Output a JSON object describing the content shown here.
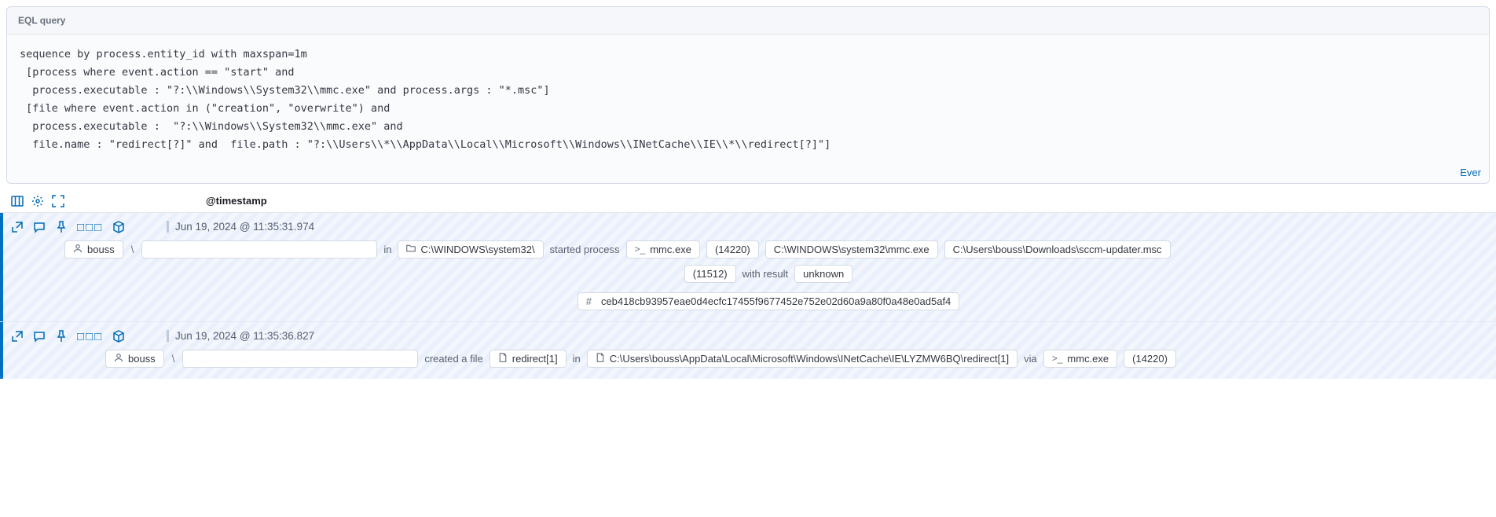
{
  "panel": {
    "title": "EQL query",
    "query": "sequence by process.entity_id with maxspan=1m\n [process where event.action == \"start\" and\n  process.executable : \"?:\\\\Windows\\\\System32\\\\mmc.exe\" and process.args : \"*.msc\"]\n [file where event.action in (\"creation\", \"overwrite\") and\n  process.executable :  \"?:\\\\Windows\\\\System32\\\\mmc.exe\" and\n  file.name : \"redirect[?]\" and  file.path : \"?:\\\\Users\\\\*\\\\AppData\\\\Local\\\\Microsoft\\\\Windows\\\\INetCache\\\\IE\\\\*\\\\redirect[?]\"]",
    "footer_link": "Ever"
  },
  "toolbar": {
    "timestamp_header": "@timestamp"
  },
  "events": [
    {
      "timestamp": "Jun 19, 2024 @ 11:35:31.974",
      "user": "bouss",
      "sep": "\\",
      "in_label": "in",
      "working_dir": "C:\\WINDOWS\\system32\\",
      "started_label": "started process",
      "proc_name": "mmc.exe",
      "pid": "(14220)",
      "proc_path": "C:\\WINDOWS\\system32\\mmc.exe",
      "arg_path": "C:\\Users\\bouss\\Downloads\\sccm-updater.msc",
      "child_pid": "(11512)",
      "with_result_label": "with result",
      "result": "unknown",
      "hash_prefix": "#",
      "hash": "ceb418cb93957eae0d4ecfc17455f9677452e752e02d60a9a80f0a48e0ad5af4"
    },
    {
      "timestamp": "Jun 19, 2024 @ 11:35:36.827",
      "user": "bouss",
      "sep": "\\",
      "created_label": "created a file",
      "file_name": "redirect[1]",
      "in_label": "in",
      "file_path": "C:\\Users\\bouss\\AppData\\Local\\Microsoft\\Windows\\INetCache\\IE\\LYZMW6BQ\\redirect[1]",
      "via_label": "via",
      "proc_name": "mmc.exe",
      "pid": "(14220)"
    }
  ]
}
